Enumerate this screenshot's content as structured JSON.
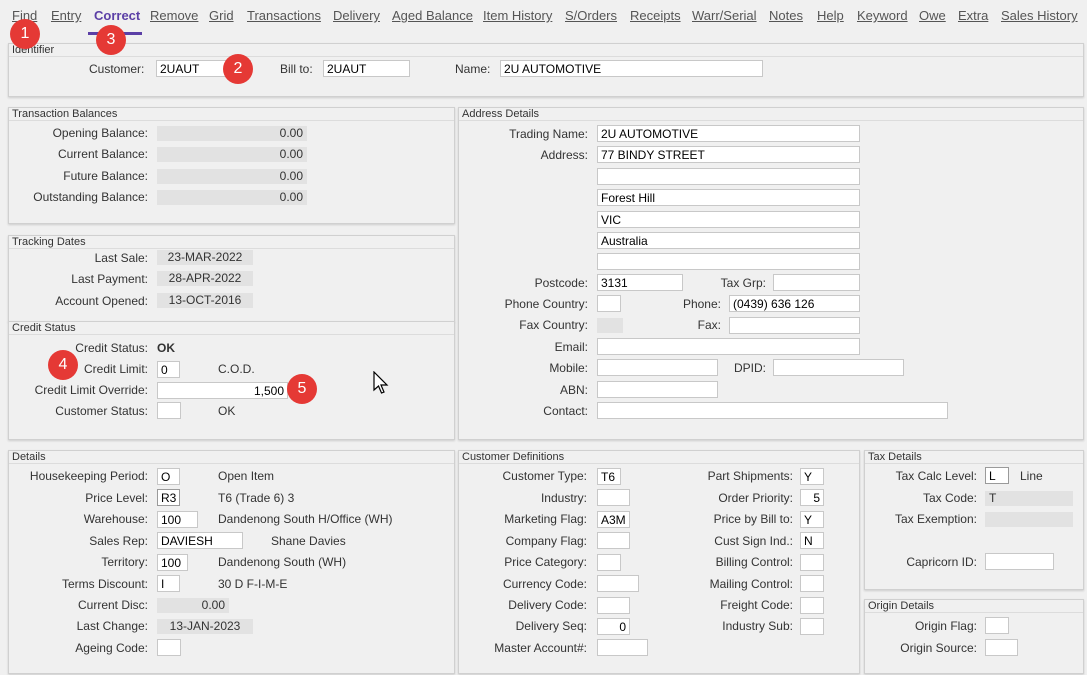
{
  "menu": [
    "Find",
    "Entry",
    "Correct",
    "Remove",
    "Grid",
    "Transactions",
    "Delivery",
    "Aged Balance",
    "Item History",
    "S/Orders",
    "Receipts",
    "Warr/Serial",
    "Notes",
    "Help",
    "Keyword",
    "Owe",
    "Extra",
    "Sales History"
  ],
  "identifier": {
    "title": "Identifier",
    "customer_label": "Customer:",
    "customer_value": "2UAUT",
    "billto_label": "Bill to:",
    "billto_value": "2UAUT",
    "name_label": "Name:",
    "name_value": "2U AUTOMOTIVE"
  },
  "balances": {
    "title": "Transaction Balances",
    "rows": [
      {
        "label": "Opening Balance:",
        "value": "0.00"
      },
      {
        "label": "Current Balance:",
        "value": "0.00"
      },
      {
        "label": "Future Balance:",
        "value": "0.00"
      },
      {
        "label": "Outstanding Balance:",
        "value": "0.00"
      }
    ]
  },
  "tracking": {
    "title": "Tracking Dates",
    "rows": [
      {
        "label": "Last Sale:",
        "value": "23-MAR-2022"
      },
      {
        "label": "Last Payment:",
        "value": "28-APR-2022"
      },
      {
        "label": "Account Opened:",
        "value": "13-OCT-2016"
      }
    ]
  },
  "credit": {
    "title": "Credit Status",
    "status_label": "Credit Status:",
    "status_value": "OK",
    "limit_label": "Credit Limit:",
    "limit_value": "0",
    "limit_desc": "C.O.D.",
    "override_label": "Credit Limit Override:",
    "override_value": "1,500",
    "cust_status_label": "Customer Status:",
    "cust_status_value": "",
    "cust_status_desc": "OK"
  },
  "address": {
    "title": "Address Details",
    "trading_label": "Trading Name:",
    "trading_value": "2U AUTOMOTIVE",
    "address_label": "Address:",
    "lines": [
      "77 BINDY STREET",
      "",
      "Forest Hill",
      "VIC",
      "Australia",
      ""
    ],
    "postcode_label": "Postcode:",
    "postcode_value": "3131",
    "taxgrp_label": "Tax Grp:",
    "taxgrp_value": "",
    "phonecountry_label": "Phone Country:",
    "phonecountry_value": "",
    "phone_label": "Phone:",
    "phone_value": "(0439) 636 126",
    "faxcountry_label": "Fax Country:",
    "fax_label": "Fax:",
    "fax_value": "",
    "email_label": "Email:",
    "email_value": "",
    "mobile_label": "Mobile:",
    "mobile_value": "",
    "dpid_label": "DPID:",
    "dpid_value": "",
    "abn_label": "ABN:",
    "abn_value": "",
    "contact_label": "Contact:",
    "contact_value": ""
  },
  "details": {
    "title": "Details",
    "rows": [
      {
        "label": "Housekeeping Period:",
        "value": "O",
        "desc": "Open Item"
      },
      {
        "label": "Price Level:",
        "value": "R3",
        "desc": "T6 (Trade 6) 3"
      },
      {
        "label": "Warehouse:",
        "value": "100",
        "desc": "Dandenong South H/Office (WH)"
      },
      {
        "label": "Sales Rep:",
        "value": "DAVIESH",
        "desc": "Shane Davies"
      },
      {
        "label": "Territory:",
        "value": "100",
        "desc": "Dandenong South (WH)"
      },
      {
        "label": "Terms Discount:",
        "value": "I",
        "desc": "30 D F-I-M-E"
      },
      {
        "label": "Current Disc:",
        "value": "0.00",
        "desc": ""
      },
      {
        "label": "Last Change:",
        "value": "13-JAN-2023",
        "desc": ""
      },
      {
        "label": "Ageing Code:",
        "value": "",
        "desc": ""
      }
    ]
  },
  "custdef": {
    "title": "Customer Definitions",
    "left": [
      {
        "label": "Customer Type:",
        "value": "T6"
      },
      {
        "label": "Industry:",
        "value": ""
      },
      {
        "label": "Marketing Flag:",
        "value": "A3M"
      },
      {
        "label": "Company Flag:",
        "value": ""
      },
      {
        "label": "Price Category:",
        "value": ""
      },
      {
        "label": "Currency Code:",
        "value": ""
      },
      {
        "label": "Delivery Code:",
        "value": ""
      },
      {
        "label": "Delivery Seq:",
        "value": "0"
      },
      {
        "label": "Master Account#:",
        "value": ""
      }
    ],
    "right": [
      {
        "label": "Part Shipments:",
        "value": "Y"
      },
      {
        "label": "Order Priority:",
        "value": "5"
      },
      {
        "label": "Price by Bill to:",
        "value": "Y"
      },
      {
        "label": "Cust Sign Ind.:",
        "value": "N"
      },
      {
        "label": "Billing Control:",
        "value": ""
      },
      {
        "label": "Mailing Control:",
        "value": ""
      },
      {
        "label": "Freight Code:",
        "value": ""
      },
      {
        "label": "Industry Sub:",
        "value": ""
      }
    ]
  },
  "tax": {
    "title": "Tax Details",
    "calc_label": "Tax Calc Level:",
    "calc_value": "L",
    "calc_desc": "Line",
    "code_label": "Tax Code:",
    "code_value": "T",
    "exempt_label": "Tax Exemption:",
    "exempt_value": "",
    "capricorn_label": "Capricorn ID:",
    "capricorn_value": ""
  },
  "origin": {
    "title": "Origin Details",
    "flag_label": "Origin Flag:",
    "flag_value": "",
    "source_label": "Origin Source:",
    "source_value": ""
  },
  "badges": [
    "1",
    "2",
    "3",
    "4",
    "5"
  ],
  "colors": {
    "accent": "#5b3fa6",
    "badge": "#e53935"
  }
}
